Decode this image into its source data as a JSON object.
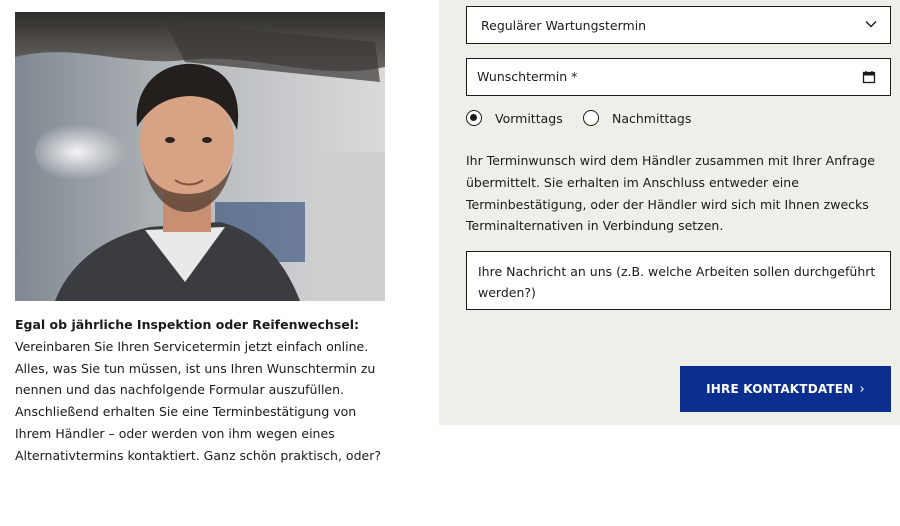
{
  "intro": {
    "lead": "Egal ob jährliche Inspektion oder Reifenwechsel:",
    "body": "Vereinbaren Sie Ihren Servicetermin jetzt einfach online. Alles, was Sie tun müssen, ist uns Ihren Wunschtermin zu nennen und das nachfolgende Formular auszufüllen. Anschließend erhalten Sie eine Terminbestätigung von Ihrem Händler – oder werden von ihm wegen eines Alternativtermins kontaktiert. Ganz schön praktisch, oder?"
  },
  "form": {
    "service_type": "Regulärer Wartungstermin",
    "date_placeholder": "Wunschtermin *",
    "time_options": [
      {
        "label": "Vormittags",
        "selected": true
      },
      {
        "label": "Nachmittags",
        "selected": false
      }
    ],
    "info_text": "Ihr Terminwunsch wird dem Händler zusammen mit Ihrer Anfrage übermittelt. Sie erhalten im Anschluss entweder eine Terminbestätigung, oder der Händler wird sich mit Ihnen zwecks Terminalternativen in Verbindung setzen.",
    "message_placeholder": "Ihre Nachricht an uns (z.B. welche Arbeiten sollen durchgeführt werden?)",
    "submit_label": "IHRE KONTAKTDATEN",
    "submit_icon": "chevron-right-icon"
  },
  "colors": {
    "panel_bg": "#efefea",
    "accent": "#0b2e8f"
  }
}
